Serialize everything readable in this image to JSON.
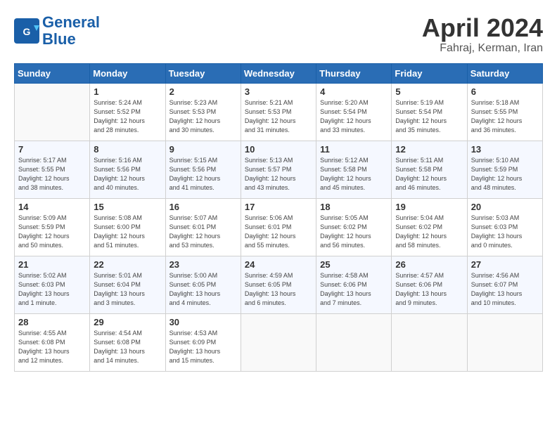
{
  "header": {
    "logo_line1": "General",
    "logo_line2": "Blue",
    "month": "April 2024",
    "location": "Fahraj, Kerman, Iran"
  },
  "weekdays": [
    "Sunday",
    "Monday",
    "Tuesday",
    "Wednesday",
    "Thursday",
    "Friday",
    "Saturday"
  ],
  "weeks": [
    [
      {
        "day": "",
        "info": ""
      },
      {
        "day": "1",
        "info": "Sunrise: 5:24 AM\nSunset: 5:52 PM\nDaylight: 12 hours\nand 28 minutes."
      },
      {
        "day": "2",
        "info": "Sunrise: 5:23 AM\nSunset: 5:53 PM\nDaylight: 12 hours\nand 30 minutes."
      },
      {
        "day": "3",
        "info": "Sunrise: 5:21 AM\nSunset: 5:53 PM\nDaylight: 12 hours\nand 31 minutes."
      },
      {
        "day": "4",
        "info": "Sunrise: 5:20 AM\nSunset: 5:54 PM\nDaylight: 12 hours\nand 33 minutes."
      },
      {
        "day": "5",
        "info": "Sunrise: 5:19 AM\nSunset: 5:54 PM\nDaylight: 12 hours\nand 35 minutes."
      },
      {
        "day": "6",
        "info": "Sunrise: 5:18 AM\nSunset: 5:55 PM\nDaylight: 12 hours\nand 36 minutes."
      }
    ],
    [
      {
        "day": "7",
        "info": "Sunrise: 5:17 AM\nSunset: 5:55 PM\nDaylight: 12 hours\nand 38 minutes."
      },
      {
        "day": "8",
        "info": "Sunrise: 5:16 AM\nSunset: 5:56 PM\nDaylight: 12 hours\nand 40 minutes."
      },
      {
        "day": "9",
        "info": "Sunrise: 5:15 AM\nSunset: 5:56 PM\nDaylight: 12 hours\nand 41 minutes."
      },
      {
        "day": "10",
        "info": "Sunrise: 5:13 AM\nSunset: 5:57 PM\nDaylight: 12 hours\nand 43 minutes."
      },
      {
        "day": "11",
        "info": "Sunrise: 5:12 AM\nSunset: 5:58 PM\nDaylight: 12 hours\nand 45 minutes."
      },
      {
        "day": "12",
        "info": "Sunrise: 5:11 AM\nSunset: 5:58 PM\nDaylight: 12 hours\nand 46 minutes."
      },
      {
        "day": "13",
        "info": "Sunrise: 5:10 AM\nSunset: 5:59 PM\nDaylight: 12 hours\nand 48 minutes."
      }
    ],
    [
      {
        "day": "14",
        "info": "Sunrise: 5:09 AM\nSunset: 5:59 PM\nDaylight: 12 hours\nand 50 minutes."
      },
      {
        "day": "15",
        "info": "Sunrise: 5:08 AM\nSunset: 6:00 PM\nDaylight: 12 hours\nand 51 minutes."
      },
      {
        "day": "16",
        "info": "Sunrise: 5:07 AM\nSunset: 6:01 PM\nDaylight: 12 hours\nand 53 minutes."
      },
      {
        "day": "17",
        "info": "Sunrise: 5:06 AM\nSunset: 6:01 PM\nDaylight: 12 hours\nand 55 minutes."
      },
      {
        "day": "18",
        "info": "Sunrise: 5:05 AM\nSunset: 6:02 PM\nDaylight: 12 hours\nand 56 minutes."
      },
      {
        "day": "19",
        "info": "Sunrise: 5:04 AM\nSunset: 6:02 PM\nDaylight: 12 hours\nand 58 minutes."
      },
      {
        "day": "20",
        "info": "Sunrise: 5:03 AM\nSunset: 6:03 PM\nDaylight: 13 hours\nand 0 minutes."
      }
    ],
    [
      {
        "day": "21",
        "info": "Sunrise: 5:02 AM\nSunset: 6:03 PM\nDaylight: 13 hours\nand 1 minute."
      },
      {
        "day": "22",
        "info": "Sunrise: 5:01 AM\nSunset: 6:04 PM\nDaylight: 13 hours\nand 3 minutes."
      },
      {
        "day": "23",
        "info": "Sunrise: 5:00 AM\nSunset: 6:05 PM\nDaylight: 13 hours\nand 4 minutes."
      },
      {
        "day": "24",
        "info": "Sunrise: 4:59 AM\nSunset: 6:05 PM\nDaylight: 13 hours\nand 6 minutes."
      },
      {
        "day": "25",
        "info": "Sunrise: 4:58 AM\nSunset: 6:06 PM\nDaylight: 13 hours\nand 7 minutes."
      },
      {
        "day": "26",
        "info": "Sunrise: 4:57 AM\nSunset: 6:06 PM\nDaylight: 13 hours\nand 9 minutes."
      },
      {
        "day": "27",
        "info": "Sunrise: 4:56 AM\nSunset: 6:07 PM\nDaylight: 13 hours\nand 10 minutes."
      }
    ],
    [
      {
        "day": "28",
        "info": "Sunrise: 4:55 AM\nSunset: 6:08 PM\nDaylight: 13 hours\nand 12 minutes."
      },
      {
        "day": "29",
        "info": "Sunrise: 4:54 AM\nSunset: 6:08 PM\nDaylight: 13 hours\nand 14 minutes."
      },
      {
        "day": "30",
        "info": "Sunrise: 4:53 AM\nSunset: 6:09 PM\nDaylight: 13 hours\nand 15 minutes."
      },
      {
        "day": "",
        "info": ""
      },
      {
        "day": "",
        "info": ""
      },
      {
        "day": "",
        "info": ""
      },
      {
        "day": "",
        "info": ""
      }
    ]
  ]
}
